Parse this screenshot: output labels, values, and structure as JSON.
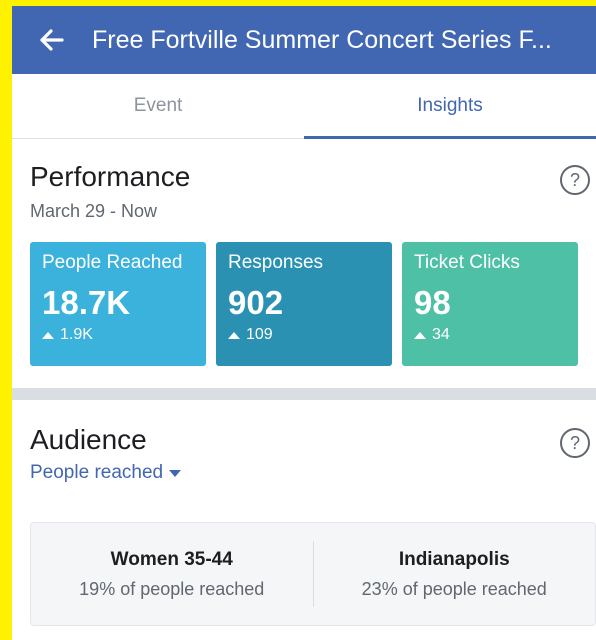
{
  "header": {
    "title": "Free Fortville Summer Concert Series F..."
  },
  "tabs": [
    {
      "label": "Event",
      "active": false
    },
    {
      "label": "Insights",
      "active": true
    }
  ],
  "performance": {
    "title": "Performance",
    "date_range": "March 29 - Now",
    "help_glyph": "?",
    "cards": [
      {
        "label": "People Reached",
        "value": "18.7K",
        "delta": "1.9K",
        "color": "#3ab2dc"
      },
      {
        "label": "Responses",
        "value": "902",
        "delta": "109",
        "color": "#2a91b3"
      },
      {
        "label": "Ticket Clicks",
        "value": "98",
        "delta": "34",
        "color": "#4ec0a6"
      }
    ]
  },
  "audience": {
    "title": "Audience",
    "filter": "People reached",
    "help_glyph": "?",
    "items": [
      {
        "name": "Women 35-44",
        "detail": "19% of people reached"
      },
      {
        "name": "Indianapolis",
        "detail": "23% of people reached"
      }
    ]
  },
  "colors": {
    "brand": "#4267b2",
    "highlight_border": "#fff200"
  }
}
